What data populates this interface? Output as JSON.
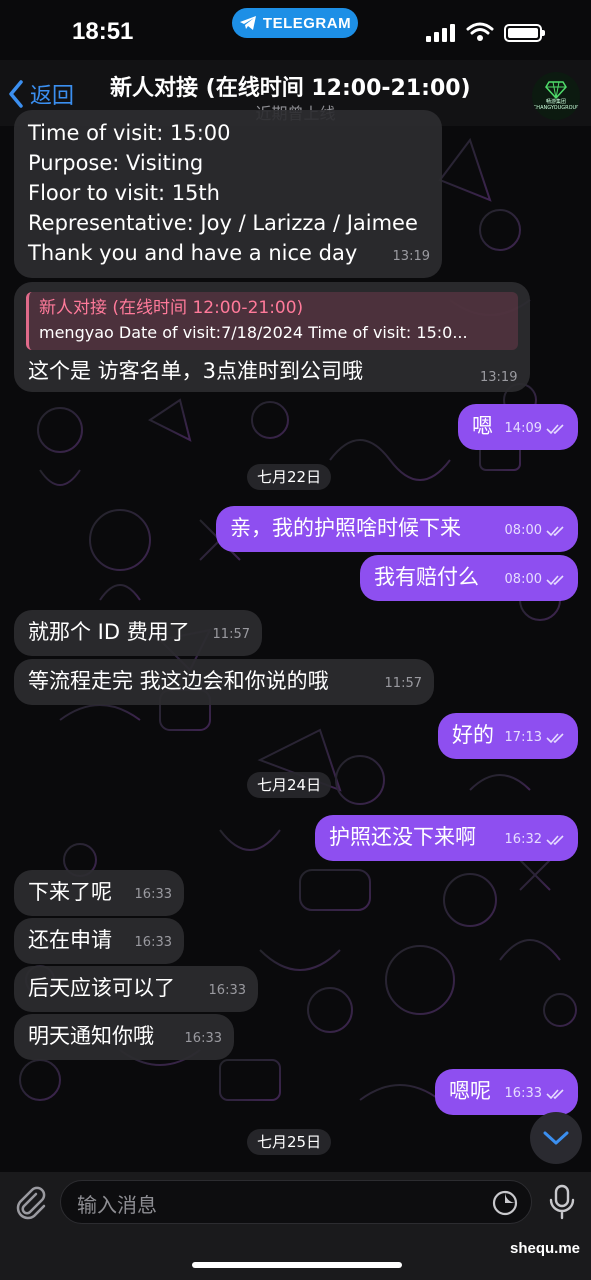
{
  "status_bar": {
    "time": "18:51",
    "app_pill": "TELEGRAM"
  },
  "header": {
    "back_label": "返回",
    "title": "新人对接 (在线时间 12:00-21:00)",
    "subtitle": "近期曾上线",
    "avatar_text": "畅游集团",
    "avatar_subtext": "CHANGYOUGROUP"
  },
  "messages": {
    "m1_lines": [
      "Time of visit: 15:00",
      "Purpose: Visiting",
      "Floor to visit: 15th",
      "Representative:  Joy / Larizza / Jaimee",
      "Thank you and have a nice day"
    ],
    "m1_time": "13:19",
    "m2_quote_name": "新人对接 (在线时间 12:00-21:00)",
    "m2_quote_text": "mengyao Date of visit:7/18/2024 Time of visit: 15:0...",
    "m2_text": "这个是 访客名单，3点准时到公司哦",
    "m2_time": "13:19",
    "m3_text": "嗯",
    "m3_time": "14:09",
    "date1": "七月22日",
    "m4_text": "亲，我的护照啥时候下来",
    "m4_time": "08:00",
    "m5_text": "我有赔付么",
    "m5_time": "08:00",
    "m6_text": "就那个 ID 费用了",
    "m6_time": "11:57",
    "m7_text": "等流程走完  我这边会和你说的哦",
    "m7_time": "11:57",
    "m8_text": "好的",
    "m8_time": "17:13",
    "date2": "七月24日",
    "m9_text": "护照还没下来啊",
    "m9_time": "16:32",
    "m10_text": "下来了呢",
    "m10_time": "16:33",
    "m11_text": "还在申请",
    "m11_time": "16:33",
    "m12_text": "后天应该可以了",
    "m12_time": "16:33",
    "m13_text": "明天通知你哦",
    "m13_time": "16:33",
    "m14_text": "嗯呢",
    "m14_time": "16:33",
    "date3": "七月25日"
  },
  "input": {
    "placeholder": "输入消息"
  },
  "watermark": "shequ.me",
  "colors": {
    "accent": "#3b8ff0",
    "outgoing_bubble": "#8e4ff0",
    "incoming_bubble": "#2c2c30",
    "telegram_pill": "#1d8fe6"
  }
}
